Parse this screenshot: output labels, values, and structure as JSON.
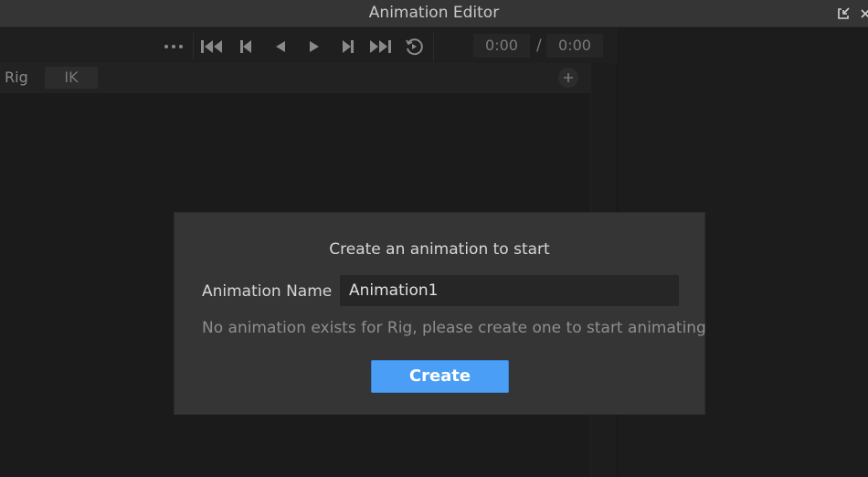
{
  "window": {
    "title": "Animation Editor",
    "buttons": {
      "dock": "dock-icon",
      "close": "close-icon"
    }
  },
  "toolbar": {
    "more": "more-icon",
    "controls": [
      "skip-to-start-icon",
      "previous-keyframe-icon",
      "play-reverse-icon",
      "play-icon",
      "next-keyframe-icon",
      "skip-to-end-icon",
      "loop-icon"
    ],
    "current_time": "0:00",
    "separator": "/",
    "total_time": "0:00"
  },
  "subbar": {
    "rig_label": "Rig",
    "ik_label": "IK",
    "add_icon": "plus-icon"
  },
  "dialog": {
    "title": "Create an animation to start",
    "name_label": "Animation Name",
    "name_value": "Animation1",
    "hint": "No animation exists for Rig, please create one to start animating",
    "create_label": "Create",
    "accent_color": "#4a9ef5"
  }
}
